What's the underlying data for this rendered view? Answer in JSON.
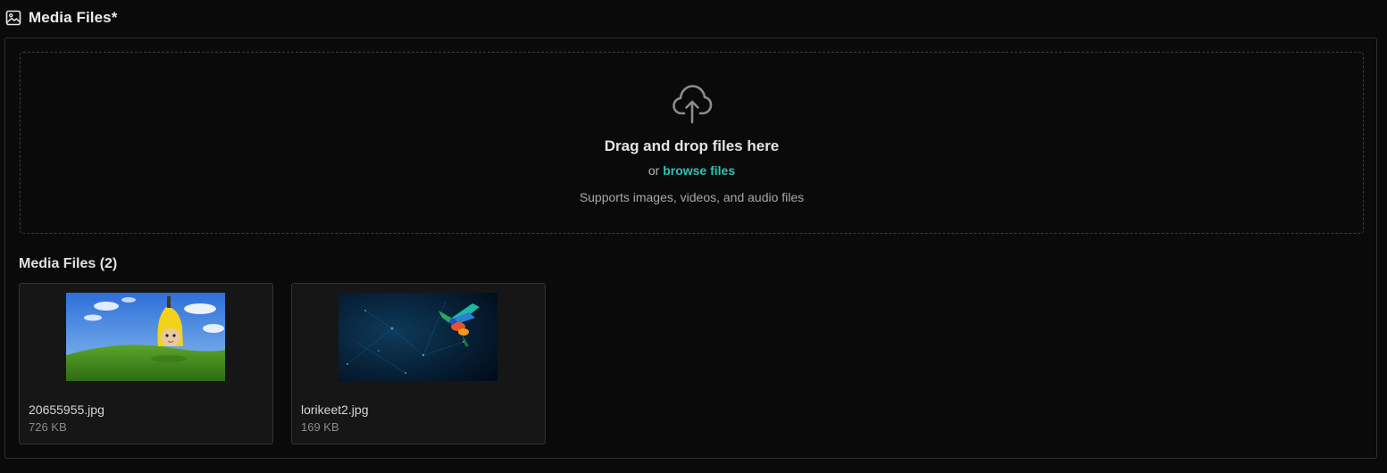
{
  "section": {
    "title": "Media Files*",
    "icon": "image-icon"
  },
  "dropzone": {
    "icon": "cloud-upload-icon",
    "title": "Drag and drop files here",
    "or_text": "or",
    "browse_label": "browse files",
    "hint": "Supports images, videos, and audio files",
    "accent_color": "#2ec4b6"
  },
  "files": {
    "heading": "Media Files (2)",
    "items": [
      {
        "name": "20655955.jpg",
        "size": "726 KB",
        "thumbnail": "cat-in-banana-costume-on-green-hill-image"
      },
      {
        "name": "lorikeet2.jpg",
        "size": "169 KB",
        "thumbnail": "colorful-parrot-on-dark-blue-background-image"
      }
    ]
  }
}
